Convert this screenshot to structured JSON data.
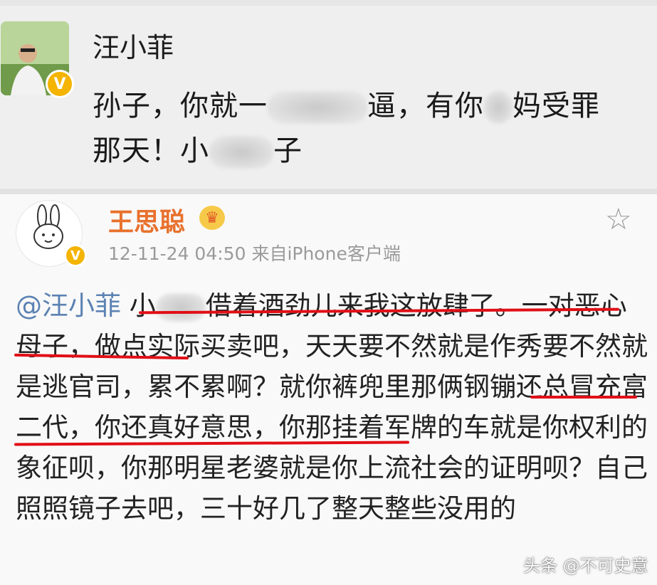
{
  "post1": {
    "username": "汪小菲",
    "line1_a": "孙子，你就一",
    "line1_b": "逼，有你",
    "line1_c": "妈受罪",
    "line2_a": "那天！小",
    "line2_b": "子"
  },
  "post2": {
    "username": "王思聪",
    "timestamp": "12-11-24 04:50",
    "source": "来自iPhone客户端",
    "mention": "@汪小菲",
    "text_a": "小",
    "text_b": "借着酒劲儿来我这放肆了。一对恶心母子，做点实际买卖吧，天天要不然就是作秀要不然就是逃官司，累不累啊？就你裤兜里那俩钢镚还总冒充富二代，你还真好意思，你那挂着军牌的车就是你权利的象征呗，你那明星老婆就是你上流社会的证明呗？自己照照镜子去吧，三十好几了整天整些没用的"
  },
  "watermark": "头条 @不可史意",
  "colors": {
    "username_orange": "#e8712d",
    "mention_blue": "#5b82b3",
    "underline_red": "#e10f16",
    "vip_gold": "#f4b400"
  },
  "icons": [
    "verified-badge-icon",
    "crown-badge-icon",
    "star-icon"
  ]
}
